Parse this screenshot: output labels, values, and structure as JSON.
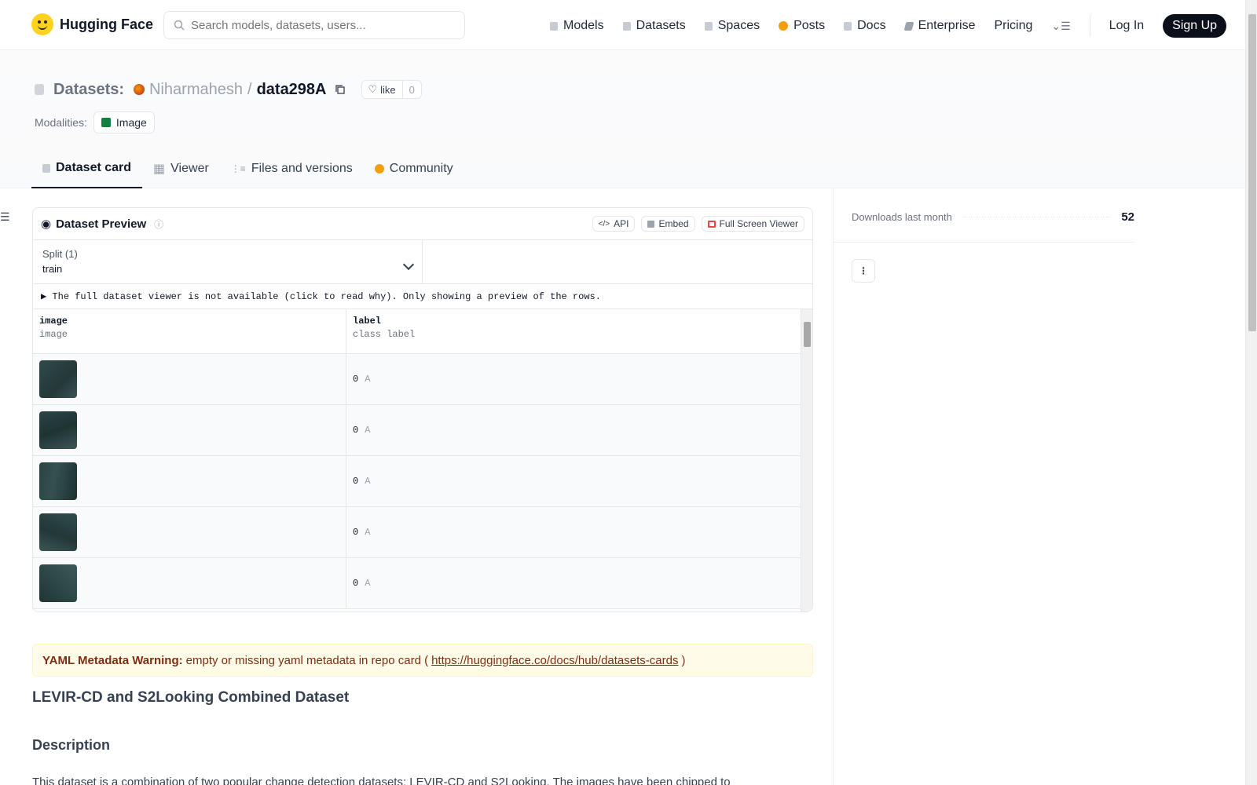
{
  "header": {
    "brand": "Hugging Face",
    "search_placeholder": "Search models, datasets, users...",
    "nav": [
      {
        "label": "Models",
        "icon": "cube-icon"
      },
      {
        "label": "Datasets",
        "icon": "database-icon"
      },
      {
        "label": "Spaces",
        "icon": "grid-icon"
      },
      {
        "label": "Posts",
        "icon": "chat-icon"
      },
      {
        "label": "Docs",
        "icon": "book-icon"
      },
      {
        "label": "Enterprise",
        "icon": "tag-icon"
      },
      {
        "label": "Pricing",
        "icon": ""
      }
    ],
    "login": "Log In",
    "signup": "Sign Up"
  },
  "repo": {
    "type_label": "Datasets:",
    "owner": "Niharmahesh",
    "separator": "/",
    "name": "data298A",
    "like_label": "like",
    "like_count": "0",
    "modalities_label": "Modalities:",
    "modality": "Image"
  },
  "tabs": [
    {
      "label": "Dataset card",
      "active": true
    },
    {
      "label": "Viewer",
      "active": false
    },
    {
      "label": "Files and versions",
      "active": false
    },
    {
      "label": "Community",
      "active": false
    }
  ],
  "preview": {
    "title": "Dataset Preview",
    "actions": [
      "API",
      "Embed",
      "Full Screen Viewer"
    ],
    "split_label": "Split (1)",
    "split_value": "train",
    "notice": "▶ The full dataset viewer is not available (click to read why). Only showing a preview of the rows.",
    "columns": [
      {
        "name": "image",
        "type": "image"
      },
      {
        "name": "label",
        "type": "class label"
      }
    ],
    "rows": [
      {
        "label_id": "0",
        "label_name": "A"
      },
      {
        "label_id": "0",
        "label_name": "A"
      },
      {
        "label_id": "0",
        "label_name": "A"
      },
      {
        "label_id": "0",
        "label_name": "A"
      },
      {
        "label_id": "0",
        "label_name": "A"
      }
    ]
  },
  "card": {
    "yaml_warning_bold": "YAML Metadata Warning:",
    "yaml_warning_text": "empty or missing yaml metadata in repo card (",
    "yaml_link": "https://huggingface.co/docs/hub/datasets-cards",
    "yaml_close": ")",
    "title": "LEVIR-CD and S2Looking Combined Dataset",
    "section": "Description",
    "paragraph": "This dataset is a combination of two popular change detection datasets: LEVIR-CD and S2Looking. The images have been chipped to"
  },
  "sidebar": {
    "downloads_label": "Downloads last month",
    "downloads_value": "52"
  },
  "colors": {
    "brand_yellow": "#ffd21e",
    "signup_bg": "#0b0f19",
    "yaml_bg": "#fefce8",
    "yaml_text": "#7c2d12"
  }
}
